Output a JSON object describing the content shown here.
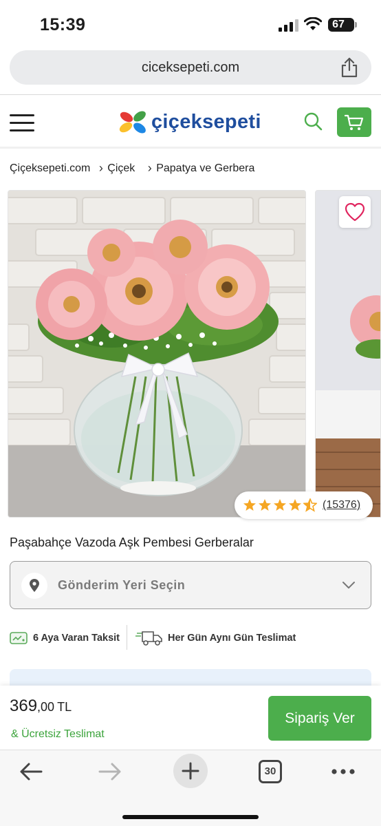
{
  "status_bar": {
    "time": "15:39",
    "battery": "67"
  },
  "browser": {
    "url": "ciceksepeti.com",
    "tab_count": "30"
  },
  "header": {
    "logo_text": "çiçeksepeti"
  },
  "breadcrumb": {
    "items": [
      "Çiçeksepeti.com",
      "Çiçek",
      "Papatya ve Gerbera"
    ]
  },
  "product": {
    "title": "Paşabahçe Vazoda Aşk Pembesi Gerberalar",
    "rating": 4.5,
    "rating_count": "(15376)",
    "location_placeholder": "Gönderim Yeri Seçin",
    "features": [
      "6 Aya Varan Taksit",
      "Her Gün Aynı Gün Teslimat"
    ],
    "price_integer": "369",
    "price_decimal": ",00",
    "currency": "TL",
    "free_shipping": "& Ücretsiz Teslimat",
    "order_button": "Sipariş Ver"
  },
  "icons": {
    "menu": "hamburger-icon",
    "search": "search-icon",
    "cart": "cart-icon",
    "favorite": "heart-icon",
    "location": "location-pin-icon",
    "dropdown": "chevron-down-icon",
    "installment": "credit-card-icon",
    "delivery": "delivery-truck-icon",
    "share": "share-icon",
    "back": "back-arrow-icon",
    "forward": "forward-arrow-icon",
    "new_tab": "plus-icon",
    "more": "more-icon"
  },
  "colors": {
    "brand_green": "#4cae4c",
    "brand_blue": "#1f4e9e",
    "star": "#f5a623",
    "heart": "#e0245e"
  }
}
